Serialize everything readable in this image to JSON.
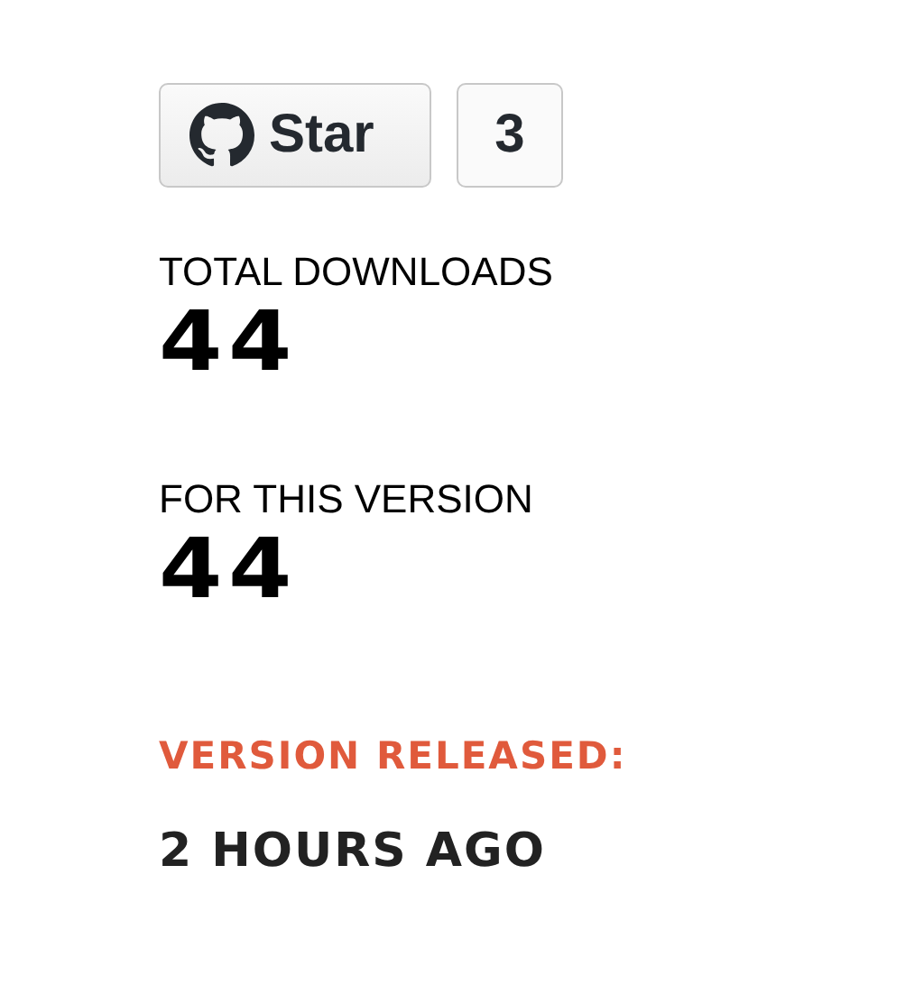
{
  "star_button": {
    "label": "Star",
    "count": "3"
  },
  "stats": [
    {
      "label": "TOTAL DOWNLOADS",
      "value": "44"
    },
    {
      "label": "FOR THIS VERSION",
      "value": "44"
    }
  ],
  "release": {
    "label": "VERSION RELEASED:",
    "value": "2 HOURS AGO"
  }
}
